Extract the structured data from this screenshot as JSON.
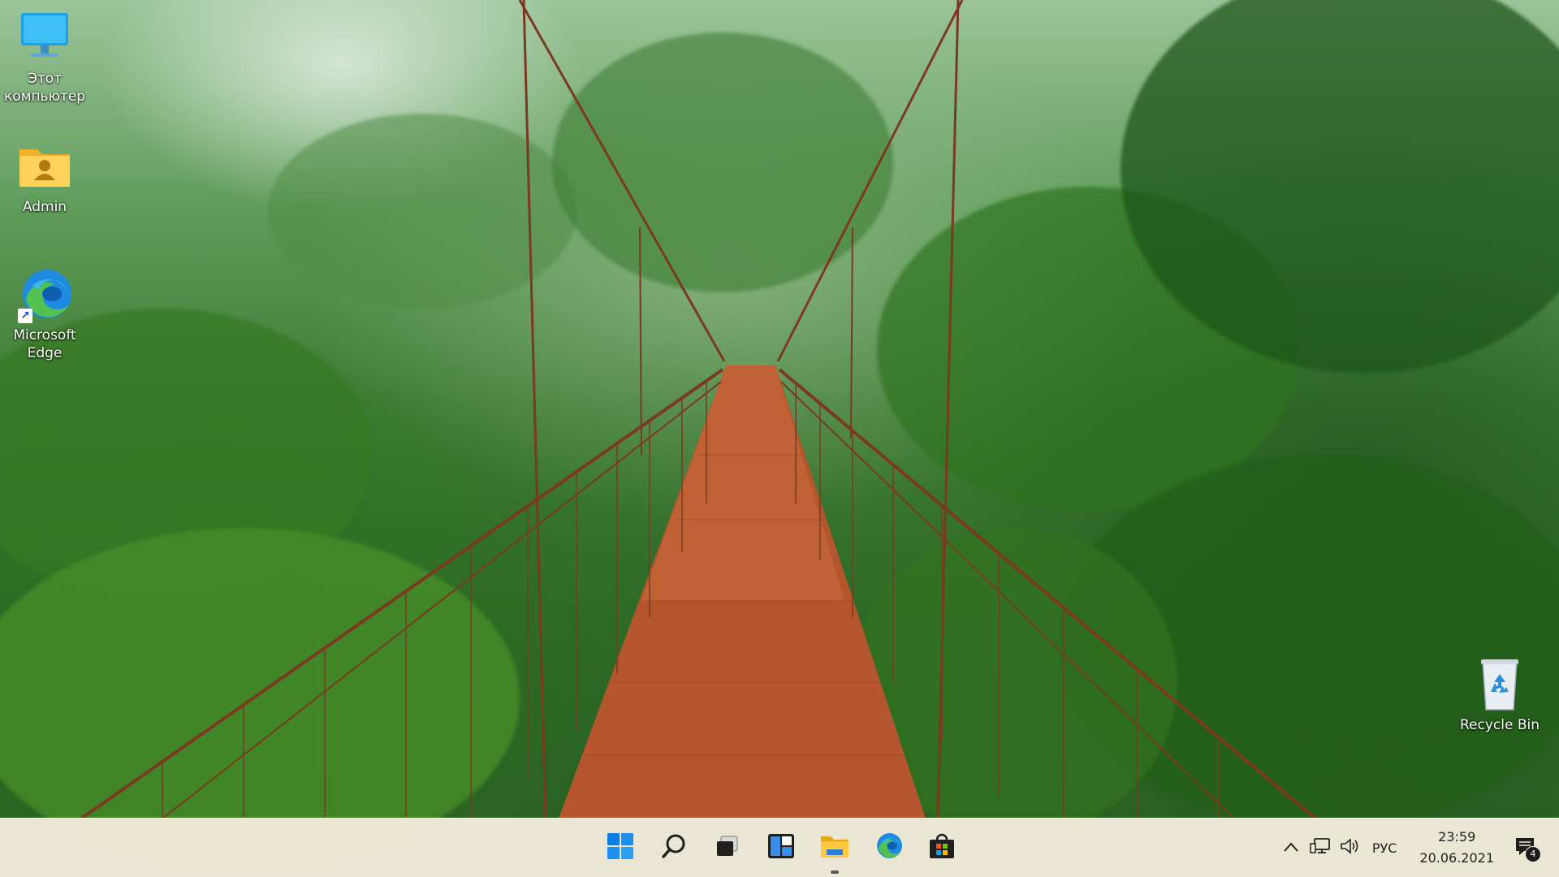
{
  "desktop": {
    "wallpaper": "rainforest suspension bridge",
    "icons": [
      {
        "label": "Этот\nкомпьютер",
        "icon": "this-pc-icon"
      },
      {
        "label": "Admin",
        "icon": "user-folder-icon"
      },
      {
        "label": "Microsoft\nEdge",
        "icon": "edge-icon"
      },
      {
        "label": "Recycle Bin",
        "icon": "recycle-bin-icon"
      }
    ]
  },
  "taskbar": {
    "apps": [
      {
        "name": "Start",
        "icon": "windows-start-icon"
      },
      {
        "name": "Search",
        "icon": "search-icon"
      },
      {
        "name": "Task View",
        "icon": "task-view-icon"
      },
      {
        "name": "Widgets",
        "icon": "widgets-icon"
      },
      {
        "name": "File Explorer",
        "icon": "file-explorer-icon",
        "active": true
      },
      {
        "name": "Microsoft Edge",
        "icon": "edge-icon"
      },
      {
        "name": "Microsoft Store",
        "icon": "store-icon"
      }
    ],
    "tray": {
      "chevron": "chevron-up-icon",
      "network": "network-icon",
      "volume": "volume-icon",
      "language": "РУС",
      "time": "23:59",
      "date": "20.06.2021",
      "notifications_count": "4"
    },
    "colors": {
      "taskbar_bg": "#f1ecdb",
      "accent_blue": "#0078d4"
    }
  }
}
